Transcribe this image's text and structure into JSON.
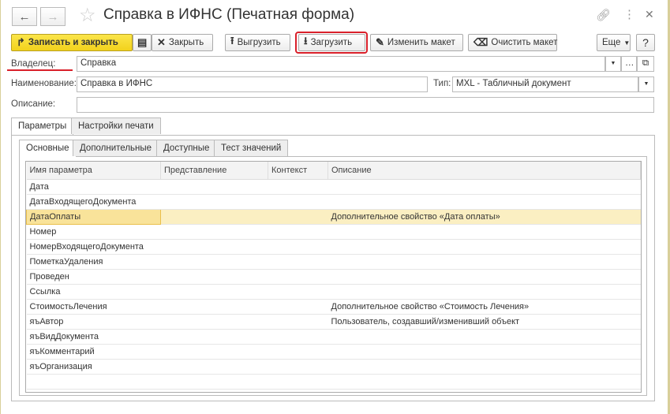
{
  "window": {
    "title": "Справка в ИФНС (Печатная форма)"
  },
  "toolbar": {
    "save_close": "Записать и закрыть",
    "close": "Закрыть",
    "upload": "Выгрузить",
    "download": "Загрузить",
    "edit_layout": "Изменить макет",
    "clear_layout": "Очистить макет",
    "more": "Еще",
    "help": "?"
  },
  "form": {
    "owner_label": "Владелец:",
    "owner_value": "Справка",
    "name_label": "Наименование:",
    "name_value": "Справка в ИФНС",
    "type_label": "Тип:",
    "type_value": "MXL - Табличный документ",
    "desc_label": "Описание:",
    "desc_value": ""
  },
  "tabs": [
    "Параметры",
    "Настройки печати"
  ],
  "subtabs": [
    "Основные",
    "Дополнительные",
    "Доступные",
    "Тест значений"
  ],
  "table": {
    "headers": [
      "Имя параметра",
      "Представление",
      "Контекст",
      "Описание"
    ],
    "rows": [
      [
        "Дата",
        "",
        "",
        ""
      ],
      [
        "ДатаВходящегоДокумента",
        "",
        "",
        ""
      ],
      [
        "ДатаОплаты",
        "",
        "",
        "Дополнительное свойство «Дата оплаты»"
      ],
      [
        "Номер",
        "",
        "",
        ""
      ],
      [
        "НомерВходящегоДокумента",
        "",
        "",
        ""
      ],
      [
        "ПометкаУдаления",
        "",
        "",
        ""
      ],
      [
        "Проведен",
        "",
        "",
        ""
      ],
      [
        "Ссылка",
        "",
        "",
        ""
      ],
      [
        "СтоимостьЛечения",
        "",
        "",
        "Дополнительное свойство «Стоимость Лечения»"
      ],
      [
        "яъАвтор",
        "",
        "",
        "Пользователь, создавший/изменивший объект"
      ],
      [
        "яъВидДокумента",
        "",
        "",
        ""
      ],
      [
        "яъКомментарий",
        "",
        "",
        ""
      ],
      [
        "яъОрганизация",
        "",
        "",
        ""
      ]
    ],
    "selected_row": 2
  }
}
